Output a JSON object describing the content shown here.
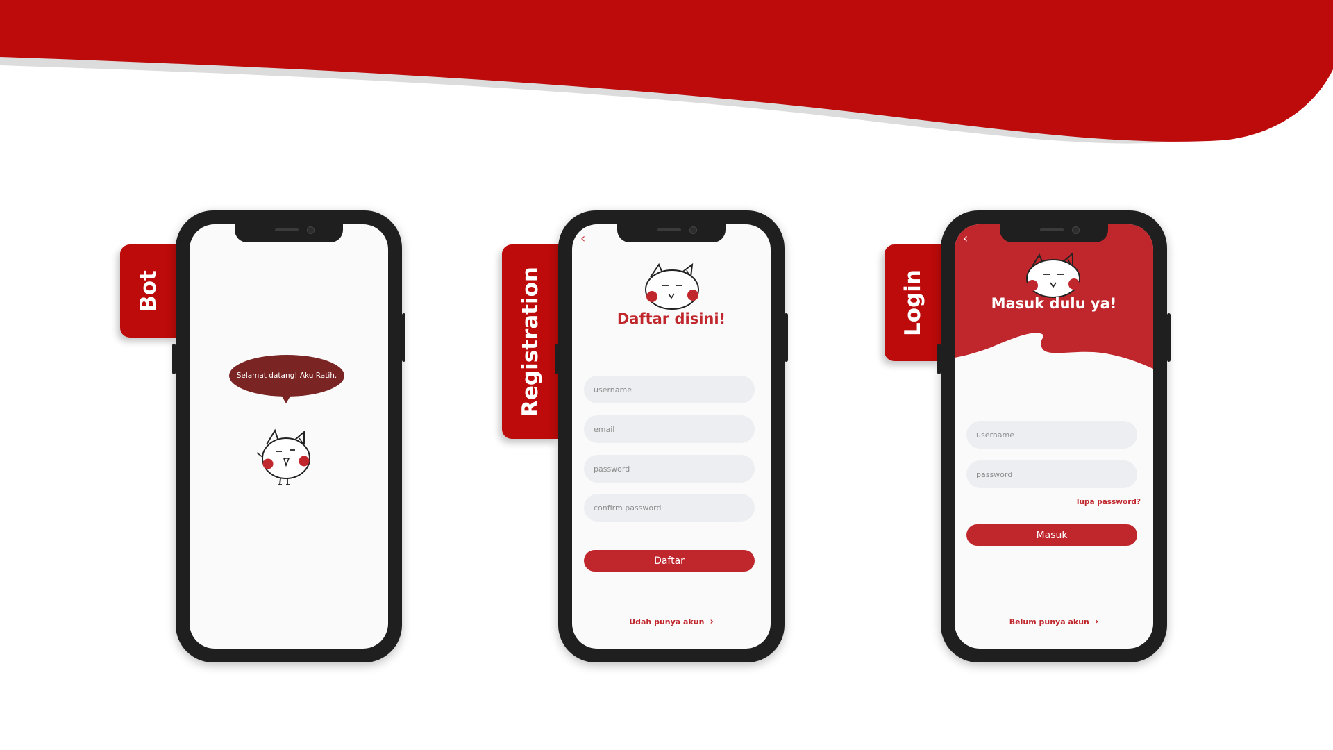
{
  "colors": {
    "brand_red": "#bd0a0a",
    "button_red": "#c0272d",
    "bubble_brown": "#7a2424",
    "field_gray": "#eceef1"
  },
  "tabs": {
    "bot": "Bot",
    "registration": "Registration",
    "login": "Login"
  },
  "bot_screen": {
    "speech": "Selamat datang! Aku Ratih.",
    "mascot": "cat-mascot-icon"
  },
  "registration_screen": {
    "back_icon": "chevron-left-icon",
    "title": "Daftar disini!",
    "fields": {
      "username": "username",
      "email": "email",
      "password": "password",
      "confirm_password": "confirm password"
    },
    "submit_label": "Daftar",
    "footer_link": "Udah punya akun",
    "footer_icon": "chevron-right-icon"
  },
  "login_screen": {
    "back_icon": "chevron-left-icon",
    "title": "Masuk dulu ya!",
    "fields": {
      "username": "username",
      "password": "password"
    },
    "forgot_link": "lupa password?",
    "submit_label": "Masuk",
    "footer_link": "Belum punya akun",
    "footer_icon": "chevron-right-icon"
  }
}
